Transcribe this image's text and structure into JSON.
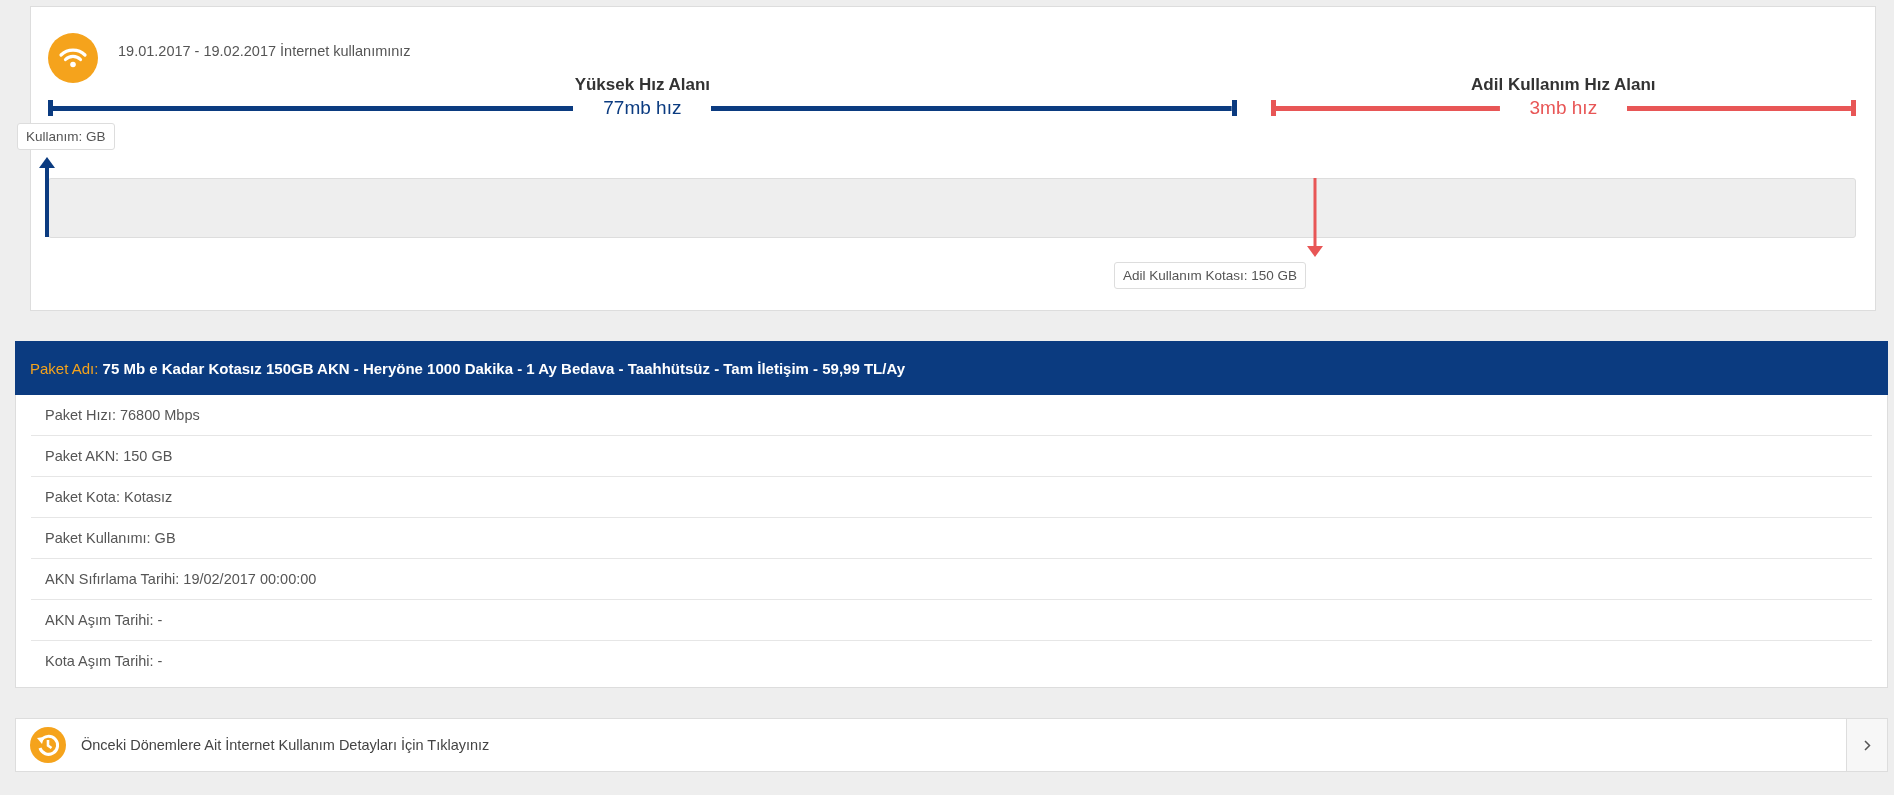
{
  "usage": {
    "title": "19.01.2017 - 19.02.2017 İnternet kullanımınız",
    "zones": [
      {
        "kind": "high",
        "title": "Yüksek Hız Alanı",
        "speed": "77mb hız"
      },
      {
        "kind": "fair",
        "title": "Adil Kullanım Hız Alanı",
        "speed": "3mb hız"
      }
    ],
    "usage_label": "Kullanım: GB",
    "level": 0,
    "quota_label": "Adil Kullanım Kotası: 150 GB"
  },
  "package": {
    "name_label": "Paket Adı:",
    "name": "75 Mb e Kadar Kotasız 150GB AKN - Heryöne 1000 Dakika - 1 Ay Bedava - Taahhütsüz - Tam İletişim - 59,99 TL/Ay",
    "details": [
      "Paket Hızı: 76800 Mbps",
      "Paket AKN: 150 GB",
      "Paket Kota: Kotasız",
      "Paket Kullanımı: GB",
      "AKN Sıfırlama Tarihi: 19/02/2017 00:00:00",
      "AKN Aşım Tarihi: -",
      "Kota Aşım Tarihi: -"
    ]
  },
  "history_link": {
    "label": "Önceki Dönemlere Ait İnternet Kullanım Detayları İçin Tıklayınız"
  }
}
